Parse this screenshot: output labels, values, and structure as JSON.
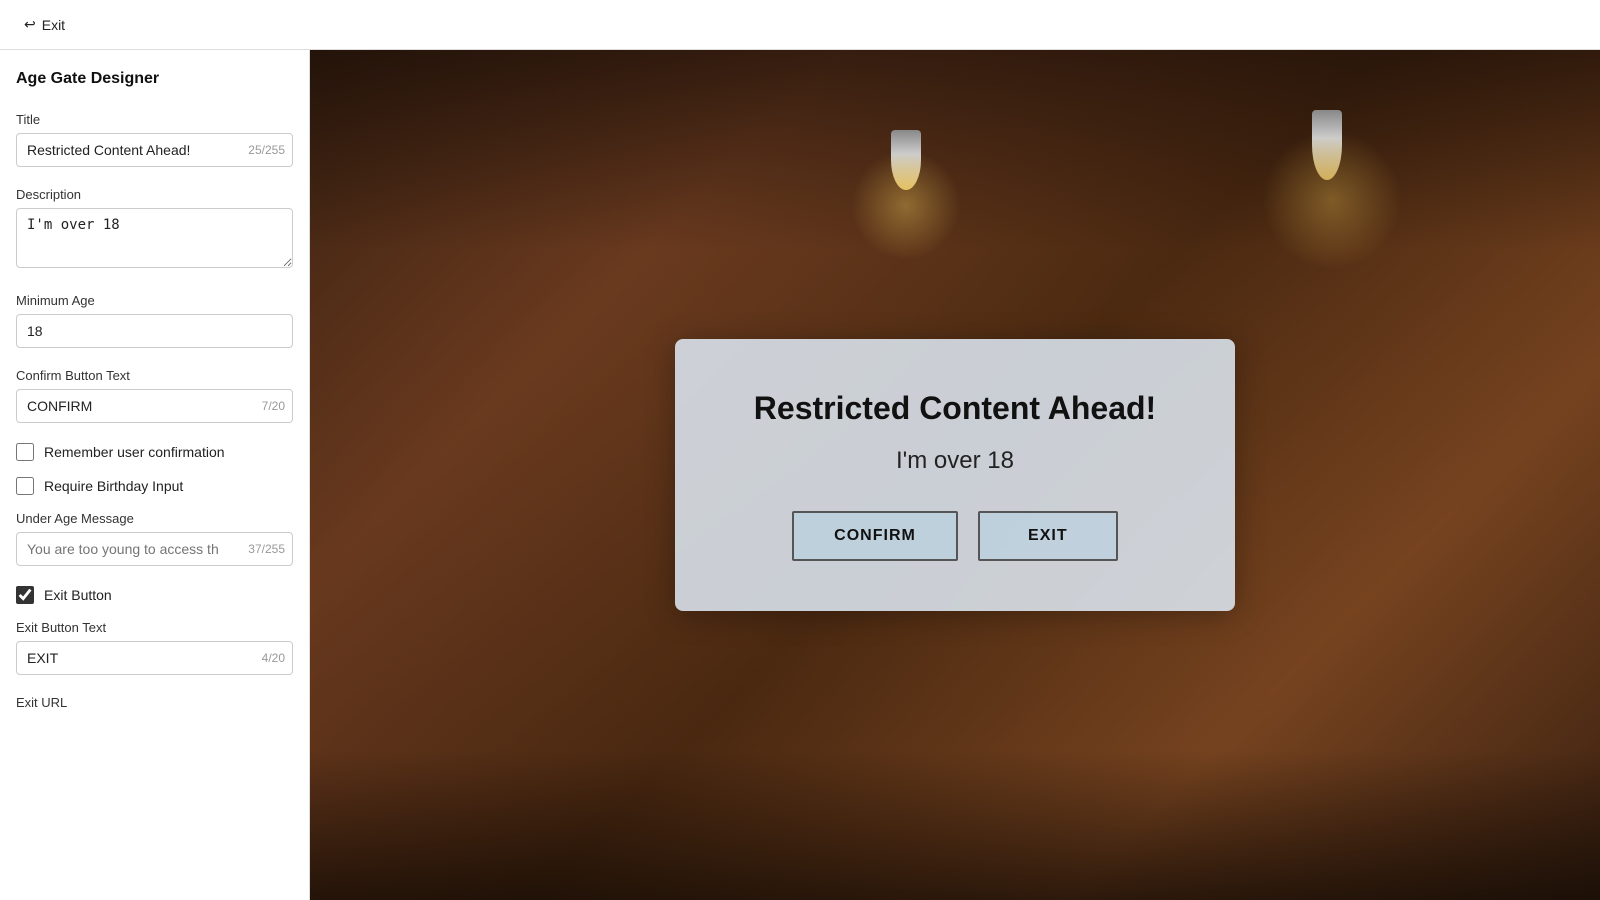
{
  "topbar": {
    "exit_label": "Exit"
  },
  "sidebar": {
    "title": "Age Gate Designer",
    "fields": {
      "title_label": "Title",
      "title_value": "Restricted Content Ahead!",
      "title_counter": "25/255",
      "description_label": "Description",
      "description_value": "I'm over 18",
      "min_age_label": "Minimum Age",
      "min_age_value": "18",
      "confirm_btn_label": "Confirm Button Text",
      "confirm_btn_value": "CONFIRM",
      "confirm_btn_counter": "7/20",
      "remember_label": "Remember user confirmation",
      "remember_checked": false,
      "birthday_label": "Require Birthday Input",
      "birthday_checked": false,
      "under_age_label": "Under Age Message",
      "under_age_value": "",
      "under_age_placeholder": "You are too young to access th",
      "under_age_counter": "37/255",
      "exit_button_label": "Exit Button",
      "exit_button_checked": true,
      "exit_btn_text_label": "Exit Button Text",
      "exit_btn_text_value": "EXIT",
      "exit_btn_text_counter": "4/20",
      "exit_url_label": "Exit URL"
    }
  },
  "modal": {
    "title": "Restricted Content Ahead!",
    "description": "I'm over 18",
    "confirm_btn": "CONFIRM",
    "exit_btn": "EXIT"
  },
  "icons": {
    "exit_arrow": "↩"
  }
}
